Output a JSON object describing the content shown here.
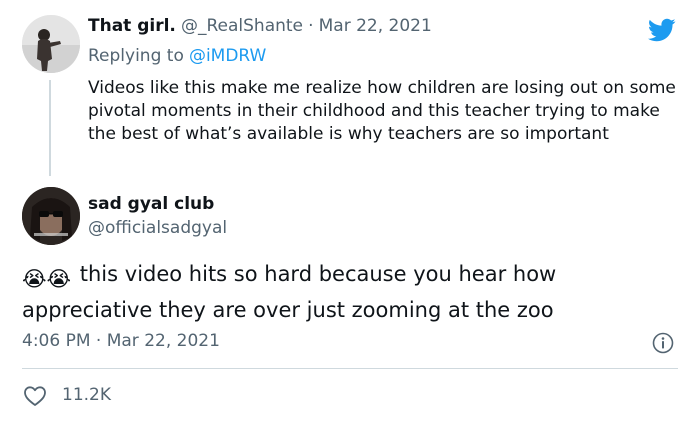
{
  "quoted_tweet": {
    "display_name": "That girl.",
    "handle": "@_RealShante",
    "separator": "·",
    "date": "Mar 22, 2021",
    "replying_prefix": "Replying to",
    "replying_handle": "@iMDRW",
    "text": "Videos like this make me realize how children are losing out on some pivotal moments in their childhood and this teacher trying to make the best of what’s available is why teachers are so important"
  },
  "main_tweet": {
    "display_name": "sad gyal club",
    "handle": "@officialsadgyal",
    "emojis": "😭😭",
    "text": "this video hits so hard because you hear how appreciative they are over just zooming at the zoo",
    "time": "4:06 PM",
    "separator": "·",
    "date": "Mar 22, 2021",
    "like_count": "11.2K"
  },
  "icons": [
    "twitter-bird-icon",
    "info-icon",
    "heart-icon"
  ],
  "colors": {
    "brand": "#1d9bf0",
    "muted": "#536471",
    "text": "#0f1419",
    "divider": "#cfd9de"
  }
}
